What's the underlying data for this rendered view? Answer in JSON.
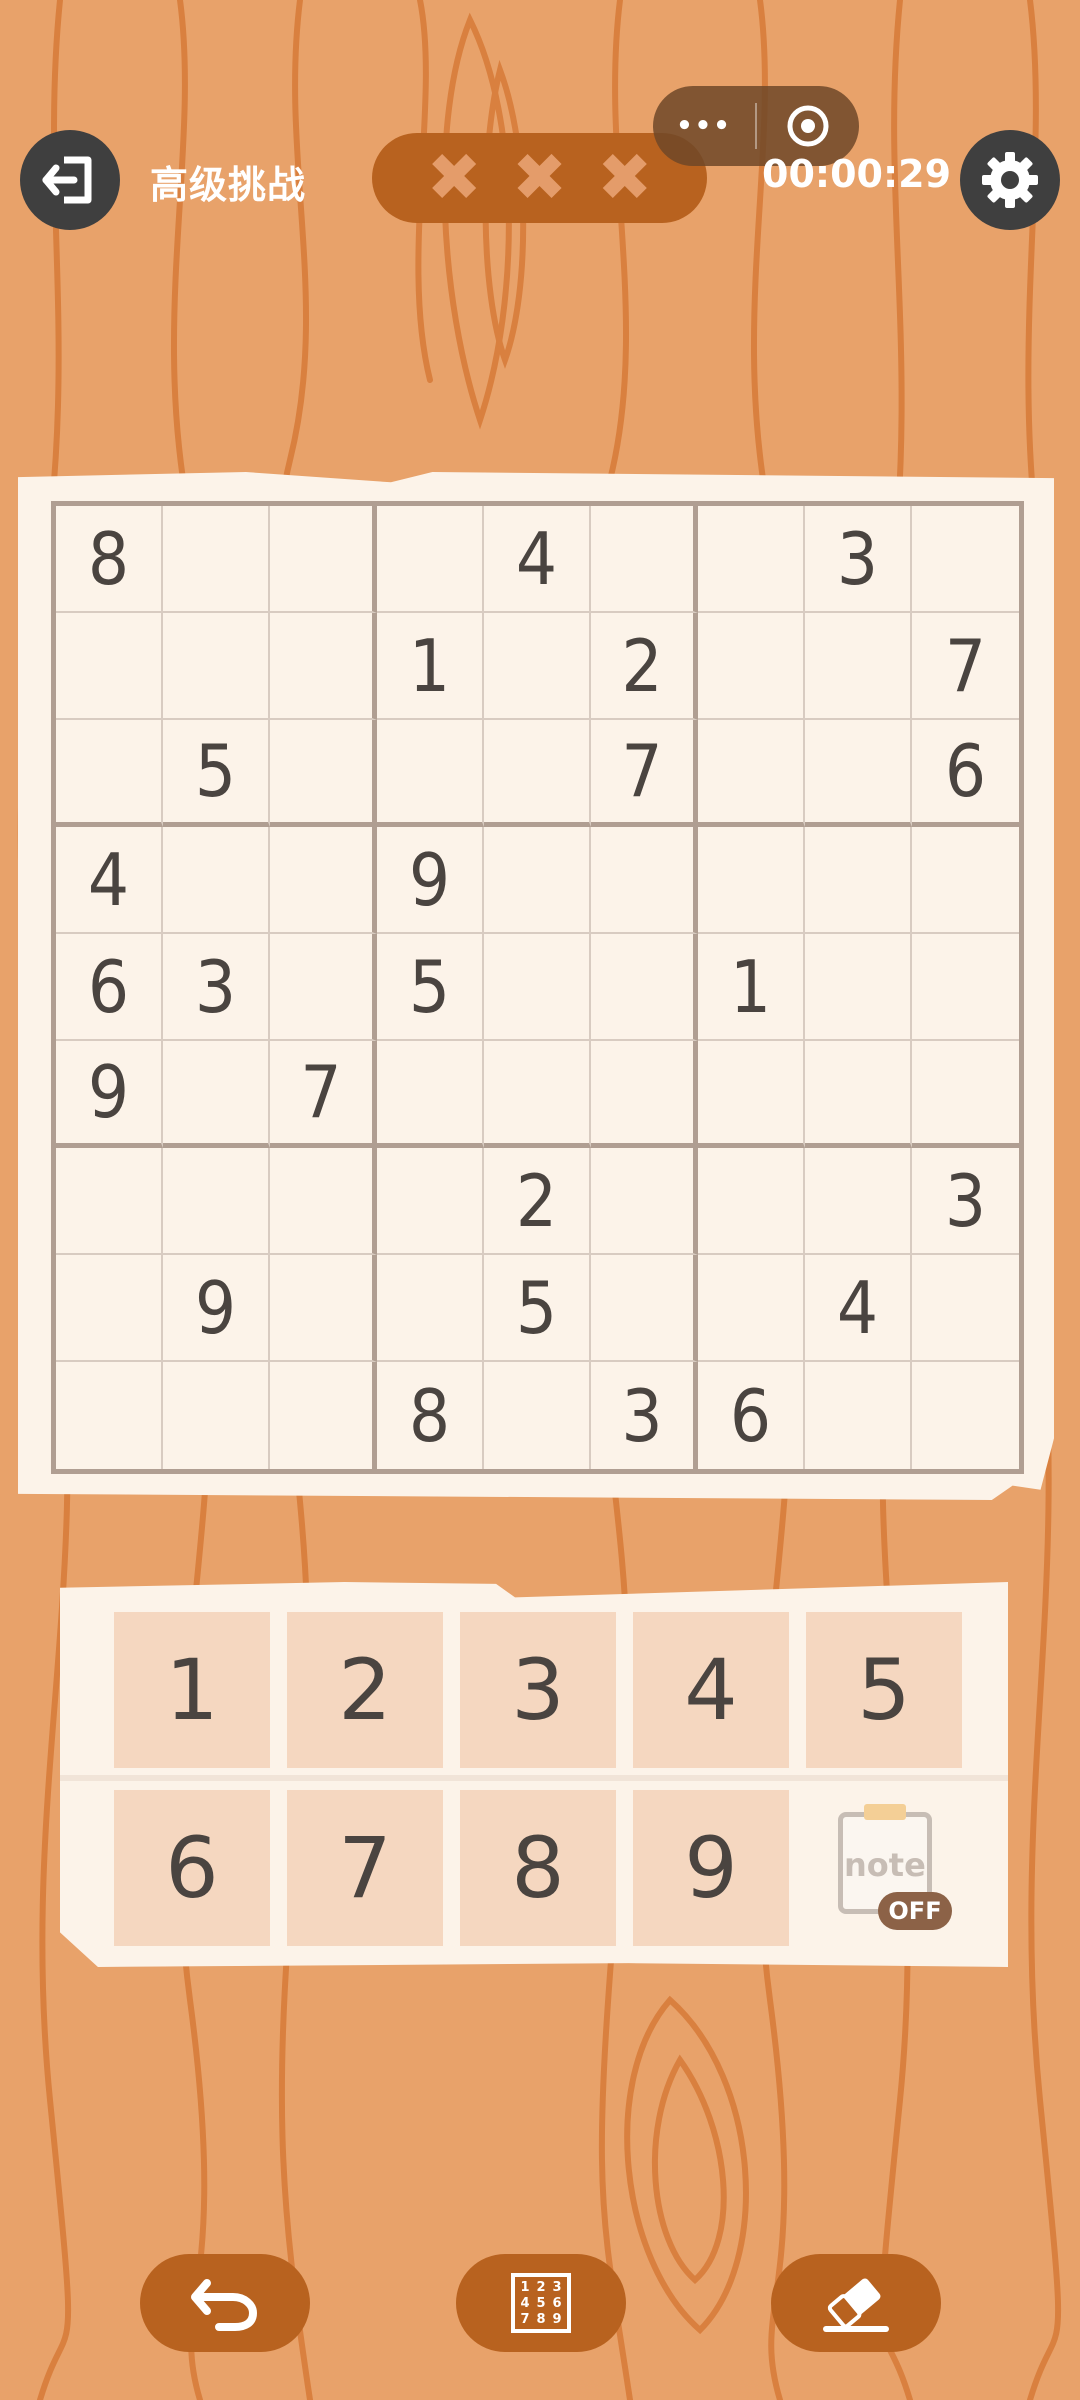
{
  "header": {
    "mode_label": "高级挑战",
    "timer": "00:00:29",
    "mistakes": [
      "✖",
      "✖",
      "✖"
    ],
    "capsule_menu_label": "•••"
  },
  "board": {
    "cells": [
      [
        "8",
        "",
        "",
        "",
        "4",
        "",
        "",
        "3",
        ""
      ],
      [
        "",
        "",
        "",
        "1",
        "",
        "2",
        "",
        "",
        "7"
      ],
      [
        "",
        "5",
        "",
        "",
        "",
        "7",
        "",
        "",
        "6"
      ],
      [
        "4",
        "",
        "",
        "9",
        "",
        "",
        "",
        "",
        ""
      ],
      [
        "6",
        "3",
        "",
        "5",
        "",
        "",
        "1",
        "",
        ""
      ],
      [
        "9",
        "",
        "7",
        "",
        "",
        "",
        "",
        "",
        ""
      ],
      [
        "",
        "",
        "",
        "",
        "2",
        "",
        "",
        "",
        "3"
      ],
      [
        "",
        "9",
        "",
        "",
        "5",
        "",
        "",
        "4",
        ""
      ],
      [
        "",
        "",
        "",
        "8",
        "",
        "3",
        "6",
        "",
        ""
      ]
    ]
  },
  "pad": {
    "keys": [
      "1",
      "2",
      "3",
      "4",
      "5",
      "6",
      "7",
      "8",
      "9"
    ],
    "note_label": "note",
    "note_state": "OFF"
  },
  "candidates_icon_digits": [
    "1",
    "2",
    "3",
    "4",
    "5",
    "6",
    "7",
    "8",
    "9"
  ],
  "colors": {
    "background": "#e8a26a",
    "wood_line": "#d9803f",
    "accent": "#b8621f",
    "paper": "#fcf3e9",
    "digit": "#4a4440",
    "key_bg": "#f5d7c0"
  },
  "icons": {
    "back": "exit-icon",
    "settings": "gear-icon",
    "undo": "undo-icon",
    "candidates": "number-grid-icon",
    "erase": "eraser-icon"
  }
}
